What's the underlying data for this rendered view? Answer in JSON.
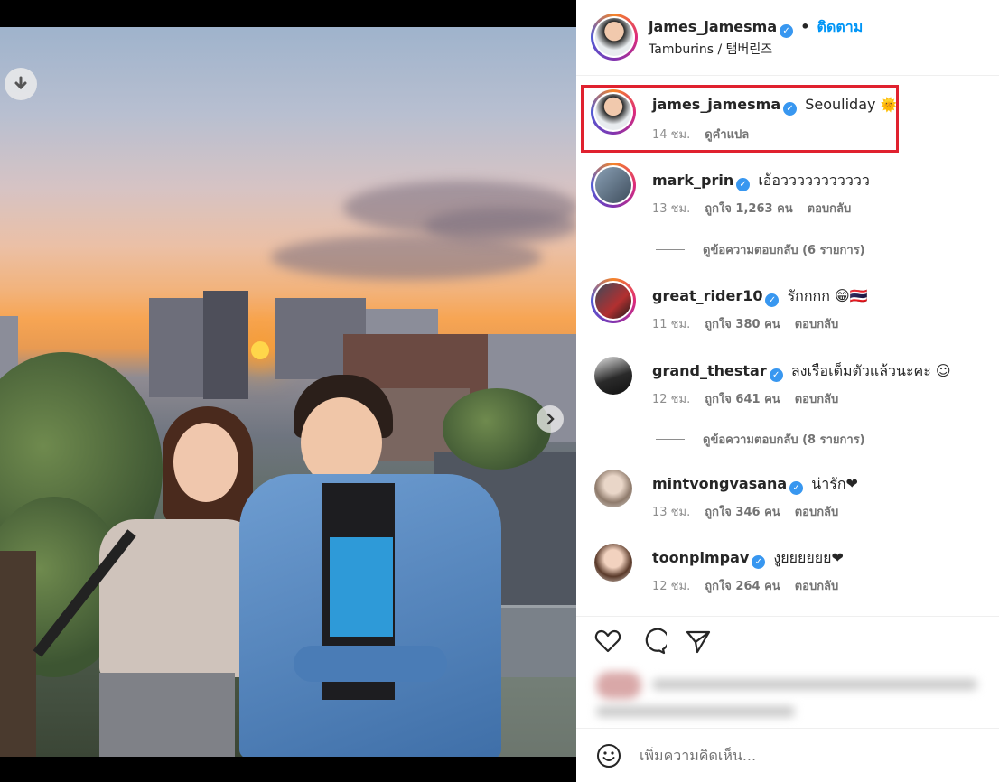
{
  "post": {
    "author": "james_jamesma",
    "follow_separator": "•",
    "follow_label": "ติดตาม",
    "location": "Tamburins / 탬버린즈"
  },
  "caption": {
    "user": "james_jamesma",
    "text": "Seouliday",
    "emoji": "🌞",
    "time": "14 ชม.",
    "translate": "ดูคำแปล"
  },
  "comments": [
    {
      "user": "mark_prin",
      "verified": true,
      "text": "เอ้อววววววววววว",
      "time": "13 ชม.",
      "likes": "ถูกใจ 1,263 คน",
      "reply": "ตอบกลับ",
      "replies_label": "ดูข้อความตอบกลับ (6 รายการ)"
    },
    {
      "user": "great_rider10",
      "verified": true,
      "text": "รักกกก 😁🇹🇭",
      "time": "11 ชม.",
      "likes": "ถูกใจ 380 คน",
      "reply": "ตอบกลับ",
      "replies_label": ""
    },
    {
      "user": "grand_thestar",
      "verified": true,
      "text": "ลงเรือเต็มตัวแล้วนะคะ ☺",
      "time": "12 ชม.",
      "likes": "ถูกใจ 641 คน",
      "reply": "ตอบกลับ",
      "replies_label": "ดูข้อความตอบกลับ (8 รายการ)"
    },
    {
      "user": "mintvongvasana",
      "verified": true,
      "text": "น่ารัก❤",
      "time": "13 ชม.",
      "likes": "ถูกใจ 346 คน",
      "reply": "ตอบกลับ",
      "replies_label": ""
    },
    {
      "user": "toonpimpav",
      "verified": true,
      "text": "งูยยยยยย❤",
      "time": "12 ชม.",
      "likes": "ถูกใจ 264 คน",
      "reply": "ตอบกลับ",
      "replies_label": ""
    }
  ],
  "actions": {
    "like_icon": "heart-icon",
    "comment_icon": "comment-icon",
    "share_icon": "send-icon"
  },
  "add_comment": {
    "placeholder": "เพิ่มความคิดเห็น...",
    "emoji_icon": "smiley-icon"
  },
  "carousel": {
    "total": 2,
    "active": 1
  },
  "colors": {
    "accent": "#0095f6",
    "verified": "#3897f0",
    "highlight": "#e0212f"
  }
}
